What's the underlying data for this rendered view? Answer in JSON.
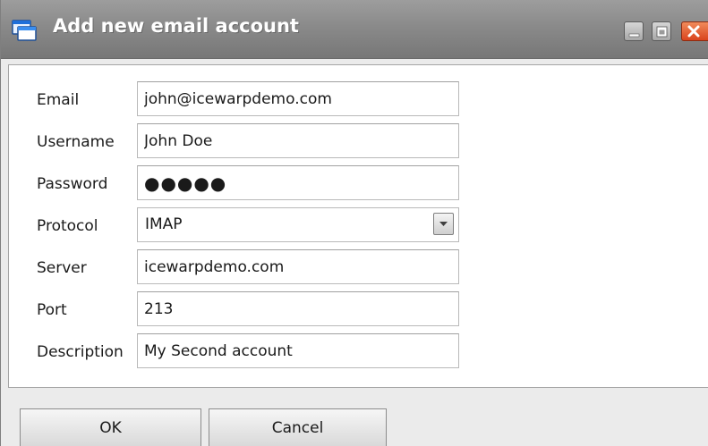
{
  "window": {
    "title": "Add new email account",
    "icon": "windows-icon",
    "controls": [
      "minimize-icon",
      "maximize-icon",
      "close-icon"
    ],
    "accent_color": "#1e6fd9",
    "close_color": "#d9441d"
  },
  "form": {
    "email": {
      "label": "Email",
      "value": "john@icewarpdemo.com"
    },
    "username": {
      "label": "Username",
      "value": "John Doe"
    },
    "password": {
      "label": "Password",
      "value": "●●●●●"
    },
    "protocol": {
      "label": "Protocol",
      "value": "IMAP",
      "icon": "chevron-down-icon"
    },
    "server": {
      "label": "Server",
      "value": "icewarpdemo.com"
    },
    "port": {
      "label": "Port",
      "value": "213"
    },
    "description": {
      "label": "Description",
      "value": "My Second account"
    }
  },
  "buttons": {
    "ok": "OK",
    "cancel": "Cancel"
  }
}
